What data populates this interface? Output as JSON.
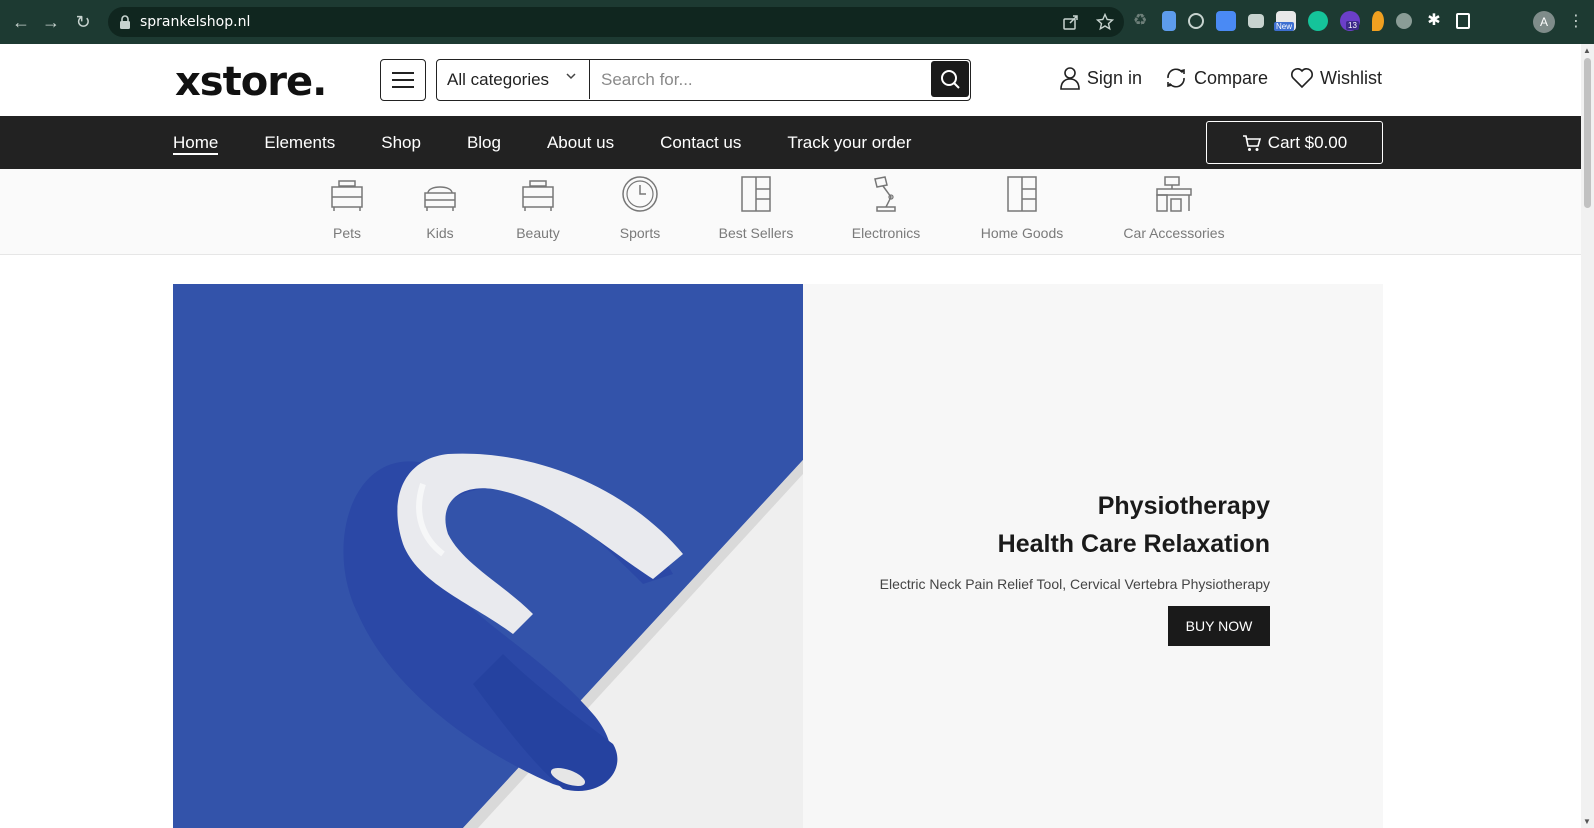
{
  "browser": {
    "url": "sprankelshop.nl",
    "extension_badge_new": "New",
    "extension_badge_count": "13",
    "profile_initial": "A"
  },
  "header": {
    "logo": "xstore.",
    "category_select": "All categories",
    "search_placeholder": "Search for...",
    "sign_in": "Sign in",
    "compare": "Compare",
    "wishlist": "Wishlist"
  },
  "nav": {
    "items": [
      "Home",
      "Elements",
      "Shop",
      "Blog",
      "About us",
      "Contact us",
      "Track your order"
    ],
    "active": "Home",
    "cart": "Cart $0.00"
  },
  "categories": [
    {
      "label": "Pets",
      "icon": "dresser-icon"
    },
    {
      "label": "Kids",
      "icon": "bed-icon"
    },
    {
      "label": "Beauty",
      "icon": "dresser-icon"
    },
    {
      "label": "Sports",
      "icon": "clock-icon"
    },
    {
      "label": "Best Sellers",
      "icon": "cabinet-icon"
    },
    {
      "label": "Electronics",
      "icon": "desk-lamp-icon"
    },
    {
      "label": "Home Goods",
      "icon": "cabinet-icon"
    },
    {
      "label": "Car Accessories",
      "icon": "desk-icon"
    }
  ],
  "hero": {
    "title_line1": "Physiotherapy",
    "title_line2": "Health Care Relaxation",
    "subtitle": "Electric Neck Pain Relief Tool, Cervical Vertebra Physiotherapy",
    "cta": "BUY NOW"
  },
  "colors": {
    "chrome_bg": "#1d3a32",
    "nav_bg": "#222222",
    "hero_blue": "#2f4fa8",
    "hero_panel": "#f7f7f7"
  }
}
